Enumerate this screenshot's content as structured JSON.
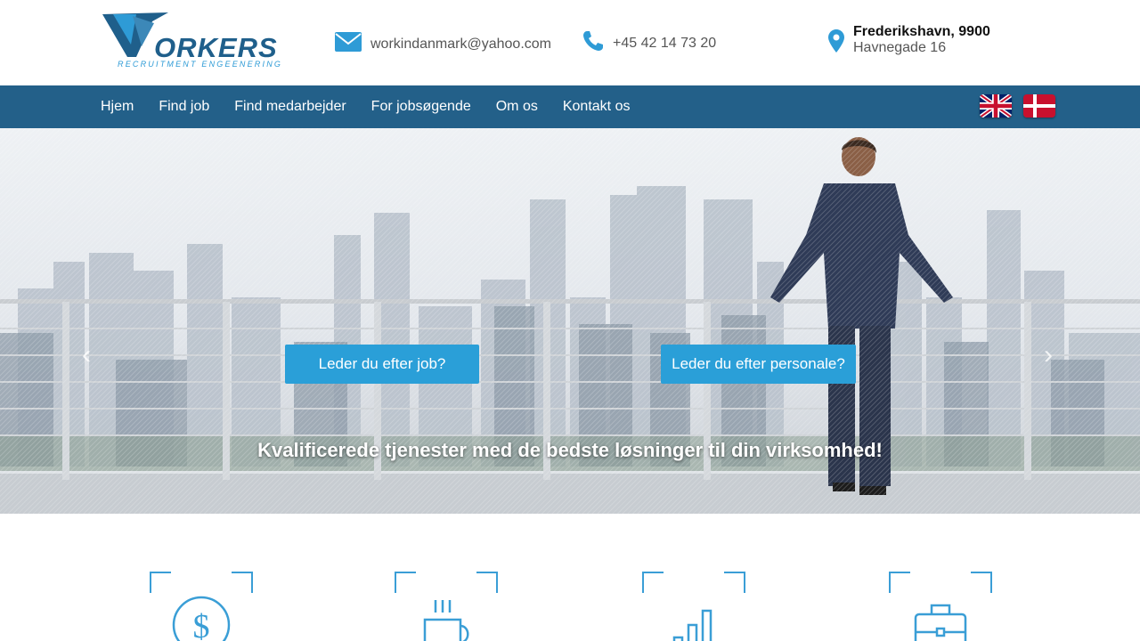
{
  "header": {
    "logo": {
      "word": "ORKERS",
      "tagline": "RECRUITMENT ENGEENERING"
    },
    "email": "workindanmark@yahoo.com",
    "phone": "+45 42 14 73 20",
    "location": {
      "city": "Frederikshavn, 9900",
      "street": "Havnegade 16"
    }
  },
  "nav": {
    "items": [
      "Hjem",
      "Find job",
      "Find medarbejder",
      "For jobsøgende",
      "Om os",
      "Kontakt os"
    ],
    "flags": [
      "english-flag",
      "danish-flag"
    ]
  },
  "hero": {
    "button_job": "Leder du efter job?",
    "button_staff": "Leder du efter personale?",
    "tagline": "Kvalificerede tjenester med de bedste løsninger til din virksomhed!",
    "arrow_left": "‹",
    "arrow_right": "›"
  },
  "features": [
    "dollar-coin-icon",
    "coffee-cup-icon",
    "bar-chart-icon",
    "briefcase-icon"
  ],
  "colors": {
    "nav_bg": "#236089",
    "accent": "#2a9fd8",
    "logo_dark": "#1f5f8b",
    "logo_light": "#2e9bd6",
    "icon_blue": "#3a9ed6"
  }
}
